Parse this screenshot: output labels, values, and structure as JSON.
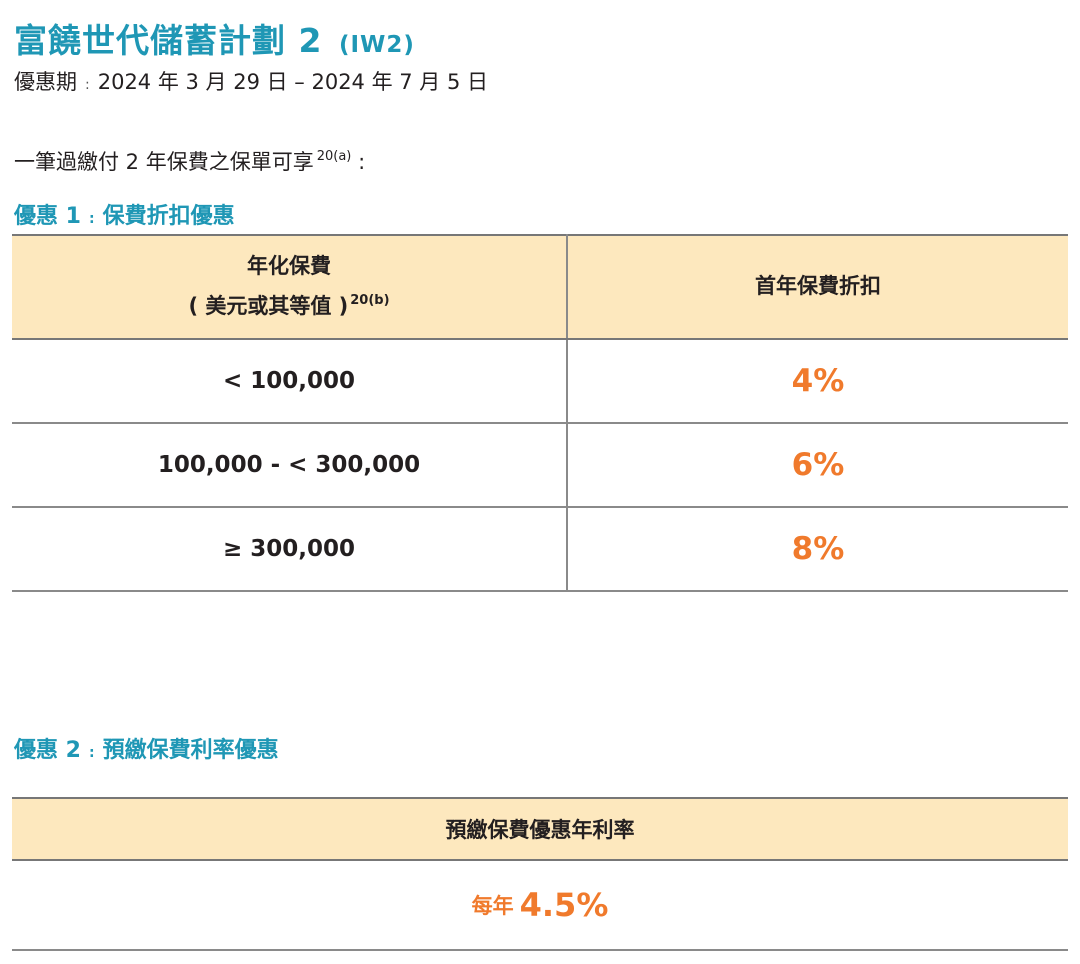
{
  "header": {
    "title": "富饒世代儲蓄計劃 2",
    "code": "(IW2)",
    "period_label": "優惠期",
    "period_sep": ":",
    "period_value": "2024 年 3 月 29 日 – 2024 年 7 月 5 日"
  },
  "intro": {
    "text": "一筆過繳付 2 年保費之保單可享",
    "footnote": "20(a)",
    "suffix": ":"
  },
  "offer1": {
    "prefix": "優惠 1",
    "sep": ":",
    "name": "保費折扣優惠",
    "col1_line1": "年化保費",
    "col1_line2": "( 美元或其等值 )",
    "col1_footnote": "20(b)",
    "col2": "首年保費折扣",
    "rows": [
      {
        "range": "< 100,000",
        "discount": "4%"
      },
      {
        "range": "100,000 - < 300,000",
        "discount": "6%"
      },
      {
        "range": "≥ 300,000",
        "discount": "8%"
      }
    ]
  },
  "offer2": {
    "prefix": "優惠 2",
    "sep": ":",
    "name": "預繳保費利率優惠",
    "header": "預繳保費優惠年利率",
    "value_prefix": "每年",
    "value": "4.5%"
  },
  "colors": {
    "title": "#1f97b5",
    "accent": "#f07a2c",
    "header_bg": "#fde8be"
  }
}
